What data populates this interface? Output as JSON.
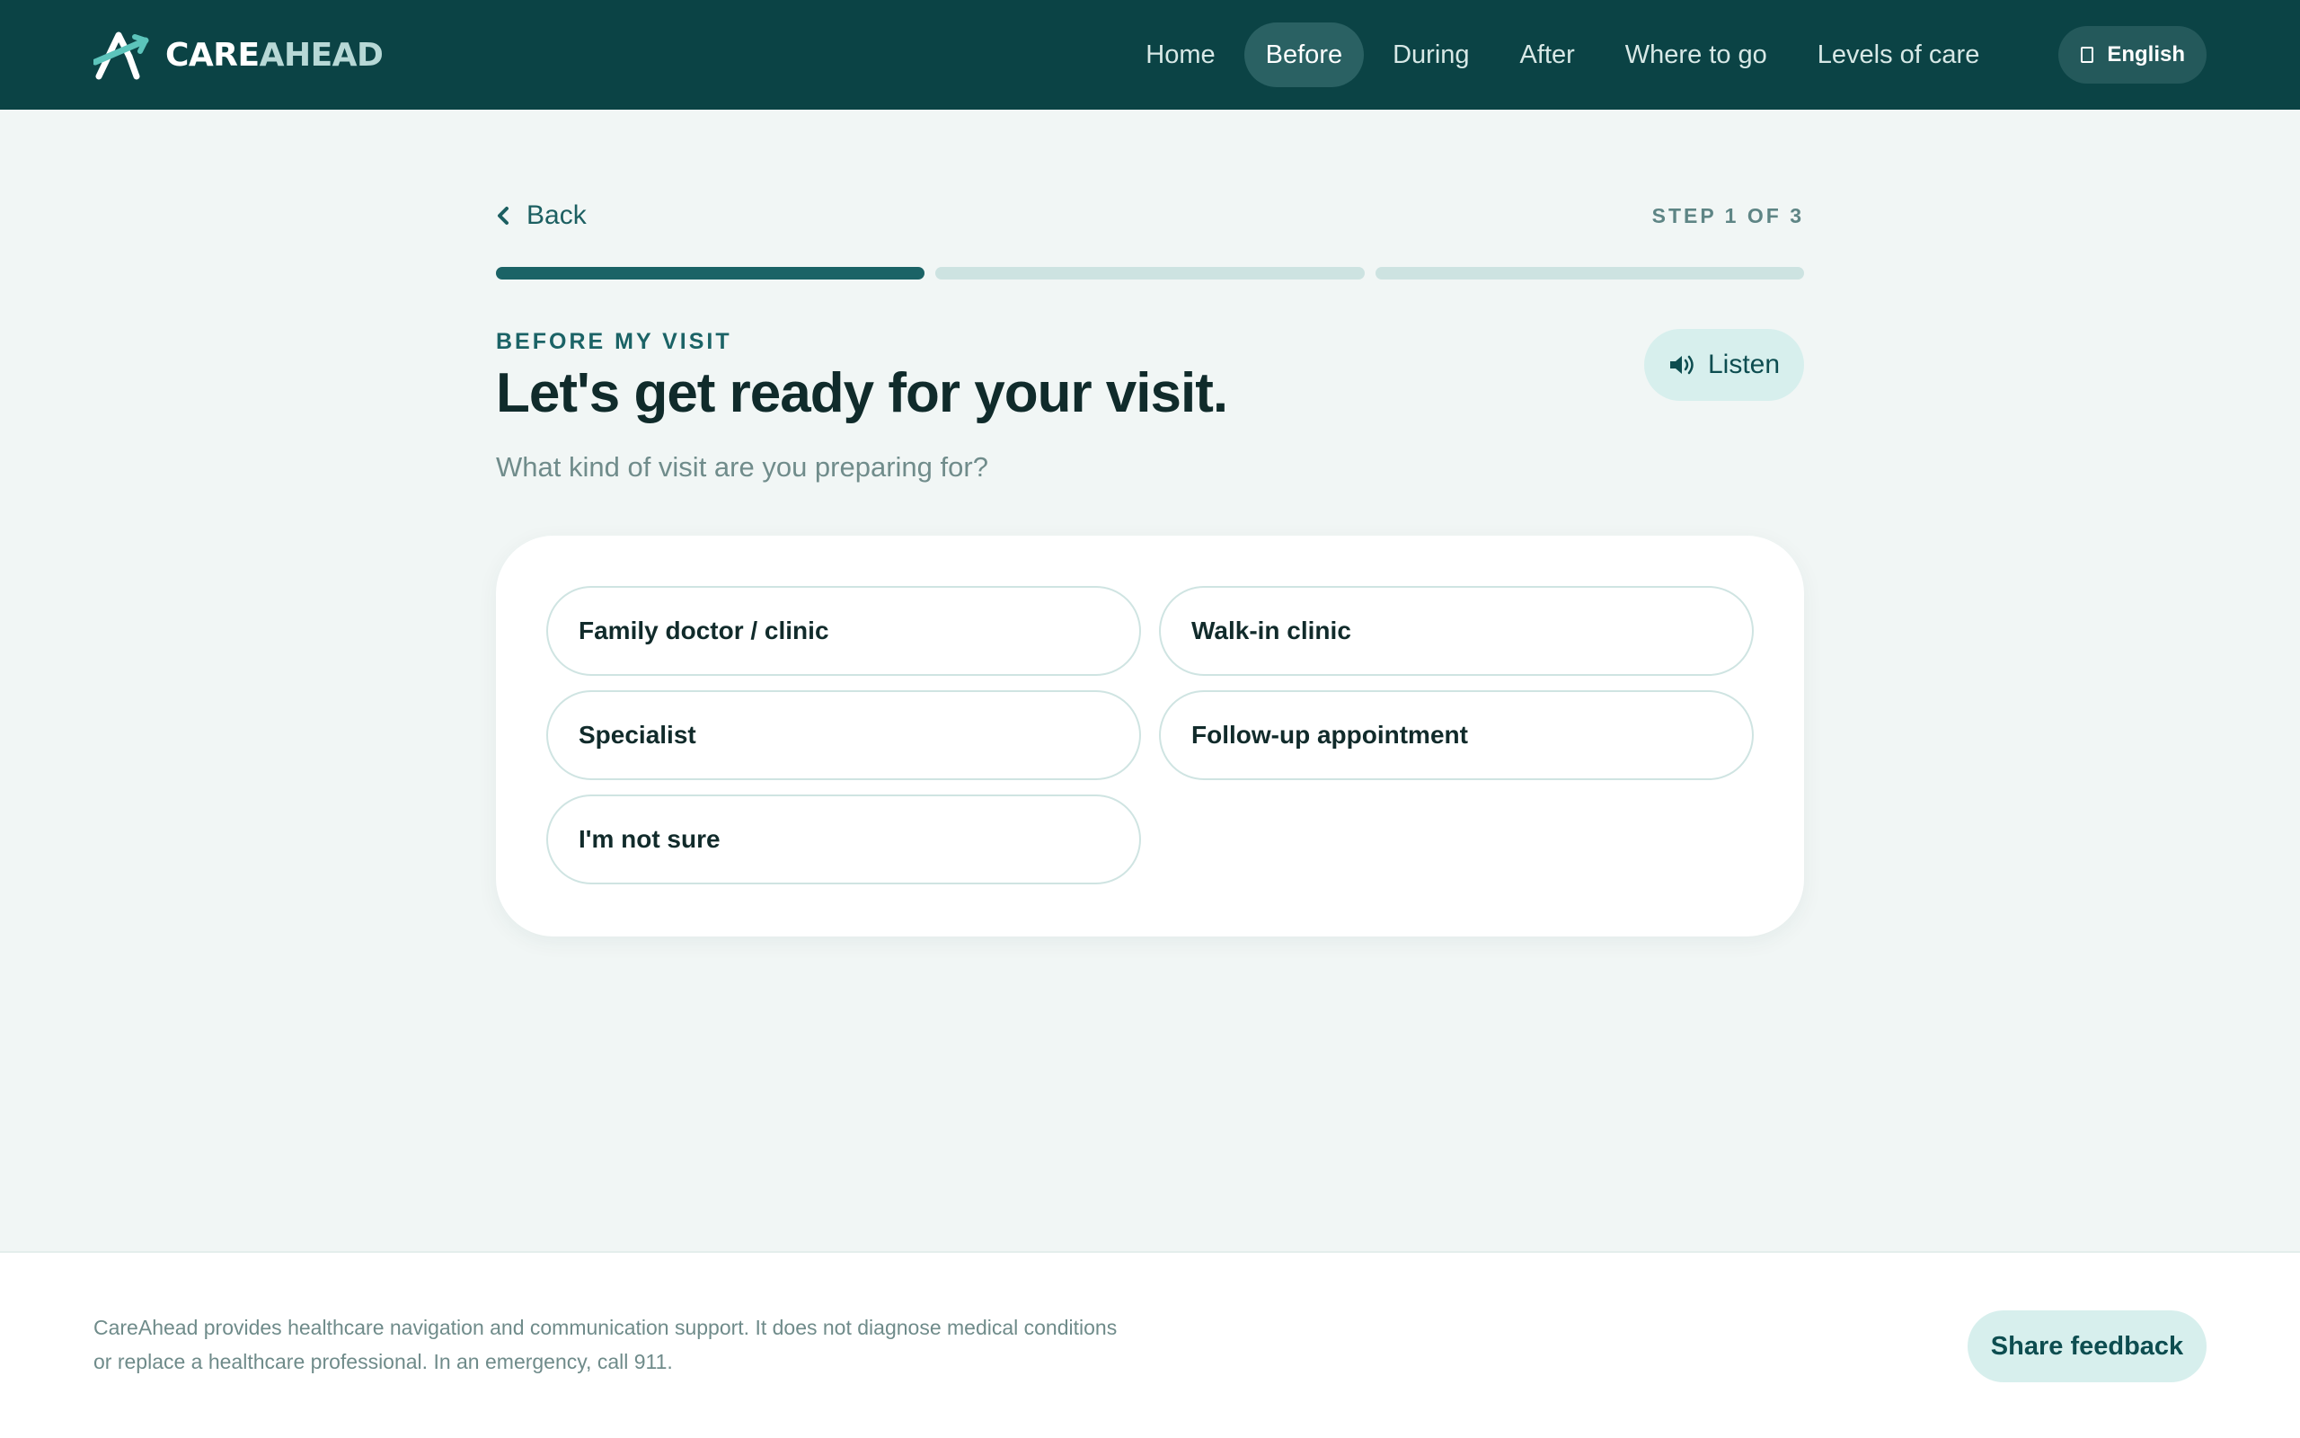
{
  "brand": {
    "name_strong": "CARE",
    "name_light": "AHEAD",
    "logo_icon": "careahead-logo-icon"
  },
  "nav": {
    "items": [
      {
        "label": "Home",
        "active": false
      },
      {
        "label": "Before",
        "active": true
      },
      {
        "label": "During",
        "active": false
      },
      {
        "label": "After",
        "active": false
      },
      {
        "label": "Where to go",
        "active": false
      },
      {
        "label": "Levels of care",
        "active": false
      }
    ],
    "language": {
      "label": "English",
      "icon": "globe-icon"
    }
  },
  "stepper": {
    "back_label": "Back",
    "back_icon": "chevron-left-icon",
    "step_text": "STEP 1 OF 3",
    "current_step": 1,
    "total_steps": 3
  },
  "intro": {
    "eyebrow": "BEFORE MY VISIT",
    "title": "Let's get ready for your visit.",
    "question": "What kind of visit are you preparing for?",
    "listen_label": "Listen",
    "listen_icon": "speaker-icon"
  },
  "options": [
    "Family doctor / clinic",
    "Walk-in clinic",
    "Specialist",
    "Follow-up appointment",
    "I'm not sure"
  ],
  "footer": {
    "disclaimer_line1": "CareAhead provides healthcare navigation and communication support. It does not diagnose medical conditions",
    "disclaimer_line2": "or replace a healthcare professional. In an emergency, call 911.",
    "feedback_label": "Share feedback"
  },
  "colors": {
    "header_bg": "#0b4345",
    "accent": "#1b6366",
    "soft_accent": "#d7efed",
    "page_bg": "#f1f6f5",
    "progress_inactive": "#cde3e1"
  }
}
